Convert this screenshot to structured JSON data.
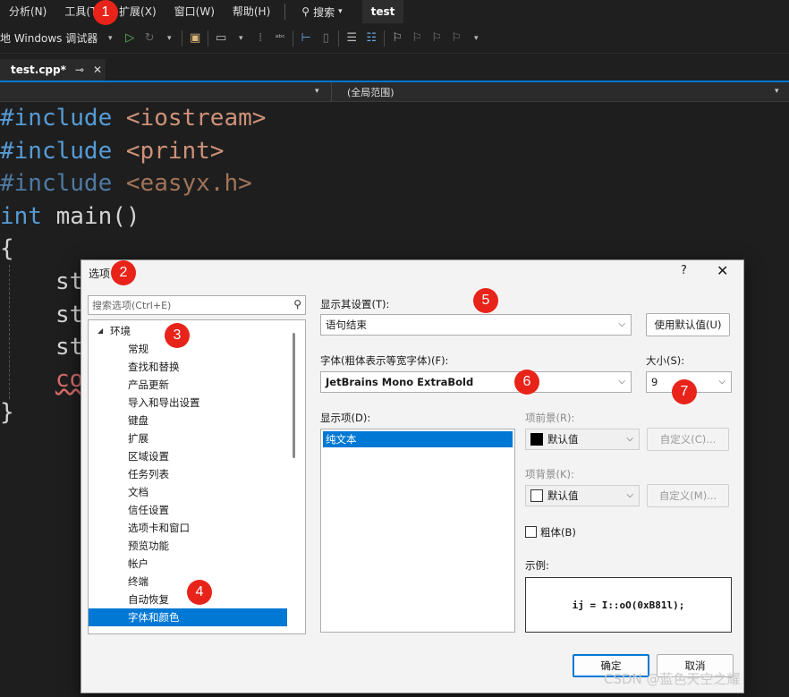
{
  "menubar": {
    "items": [
      "分析(N)",
      "工具(T)",
      "扩展(X)",
      "窗口(W)",
      "帮助(H)"
    ],
    "search_label": "搜索",
    "solution_title": "test"
  },
  "toolbar": {
    "debugger_label": "地 Windows 调试器"
  },
  "tab": {
    "title": "test.cpp*",
    "pin": "⊸",
    "close": "✕"
  },
  "navbar": {
    "scope": "(全局范围)"
  },
  "code": {
    "line1": [
      "#include",
      " ",
      "<iostream>"
    ],
    "line2": [
      "#include",
      " ",
      "<print>"
    ],
    "line3": [
      "#include",
      " ",
      "<easyx.h>"
    ],
    "line4": [
      "int",
      " ",
      "main",
      "()"
    ],
    "line5": "{",
    "line6": "st",
    "line7": "st",
    "line8": "st",
    "line9": "co",
    "line10": "}"
  },
  "dialog": {
    "title": "选项",
    "help": "?",
    "close": "✕",
    "search_placeholder": "搜索选项(Ctrl+E)",
    "tree": {
      "root": "环境",
      "items": [
        "常规",
        "查找和替换",
        "产品更新",
        "导入和导出设置",
        "键盘",
        "扩展",
        "区域设置",
        "任务列表",
        "文档",
        "信任设置",
        "选项卡和窗口",
        "预览功能",
        "帐户",
        "终端",
        "自动恢复",
        "字体和颜色"
      ],
      "selected": "字体和颜色"
    },
    "show_settings_label": "显示其设置(T):",
    "show_settings_value": "语句结束",
    "use_defaults_button": "使用默认值(U)",
    "font_label": "字体(粗体表示等宽字体)(F):",
    "font_value": "JetBrains Mono ExtraBold",
    "size_label": "大小(S):",
    "size_value": "9",
    "display_items_label": "显示项(D):",
    "display_items": [
      "纯文本"
    ],
    "foreground_label": "项前景(R):",
    "foreground_value": "默认值",
    "foreground_custom_button": "自定义(C)...",
    "background_label": "项背景(K):",
    "background_value": "默认值",
    "background_custom_button": "自定义(M)...",
    "bold_label": "粗体(B)",
    "sample_label": "示例:",
    "sample_text": "ij = I::oO(0xB81l);",
    "ok_button": "确定",
    "cancel_button": "取消"
  },
  "badges": [
    "1",
    "2",
    "3",
    "4",
    "5",
    "6",
    "7"
  ],
  "watermark": "CSDN @蓝色天空之耀",
  "colors": {
    "accent": "#0078d4",
    "badge": "#e8231a",
    "editor_bg": "#1e1e1e"
  }
}
